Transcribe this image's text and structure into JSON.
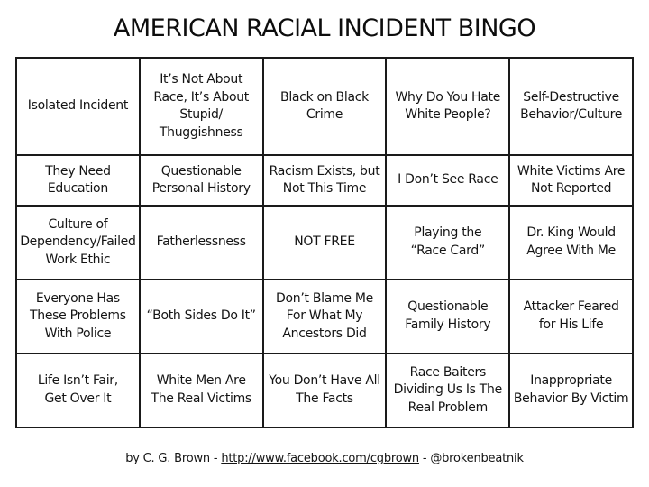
{
  "title": "AMERICAN RACIAL INCIDENT BINGO",
  "board": {
    "rows": [
      [
        "Isolated Incident",
        "It’s Not About\nRace, It’s About\nStupid/\nThuggishness",
        "Black on Black\nCrime",
        "Why Do You Hate\nWhite People?",
        "Self-Destructive\nBehavior/Culture"
      ],
      [
        "They Need\nEducation",
        "Questionable\nPersonal History",
        "Racism Exists, but\nNot This Time",
        "I Don’t See Race",
        "White Victims Are\nNot Reported"
      ],
      [
        "Culture of\nDependency/Failed\nWork Ethic",
        "Fatherlessness",
        "NOT FREE",
        "Playing the\n“Race Card”",
        "Dr. King Would\nAgree With Me"
      ],
      [
        "Everyone Has\nThese Problems\nWith Police",
        "“Both Sides Do It”",
        "Don’t Blame Me\nFor What My\nAncestors Did",
        "Questionable\nFamily History",
        "Attacker Feared\nfor His Life"
      ],
      [
        "Life Isn’t Fair,\nGet Over It",
        "White Men Are\nThe Real Victims",
        "You Don’t Have All\nThe Facts",
        "Race Baiters\nDividing Us Is The\nReal Problem",
        "Inappropriate\nBehavior By Victim"
      ]
    ]
  },
  "footer": {
    "prefix": "by C. G. Brown - ",
    "link_text": "http://www.facebook.com/cgbrown",
    "separator": " - ",
    "handle": "@brokenbeatnik"
  }
}
